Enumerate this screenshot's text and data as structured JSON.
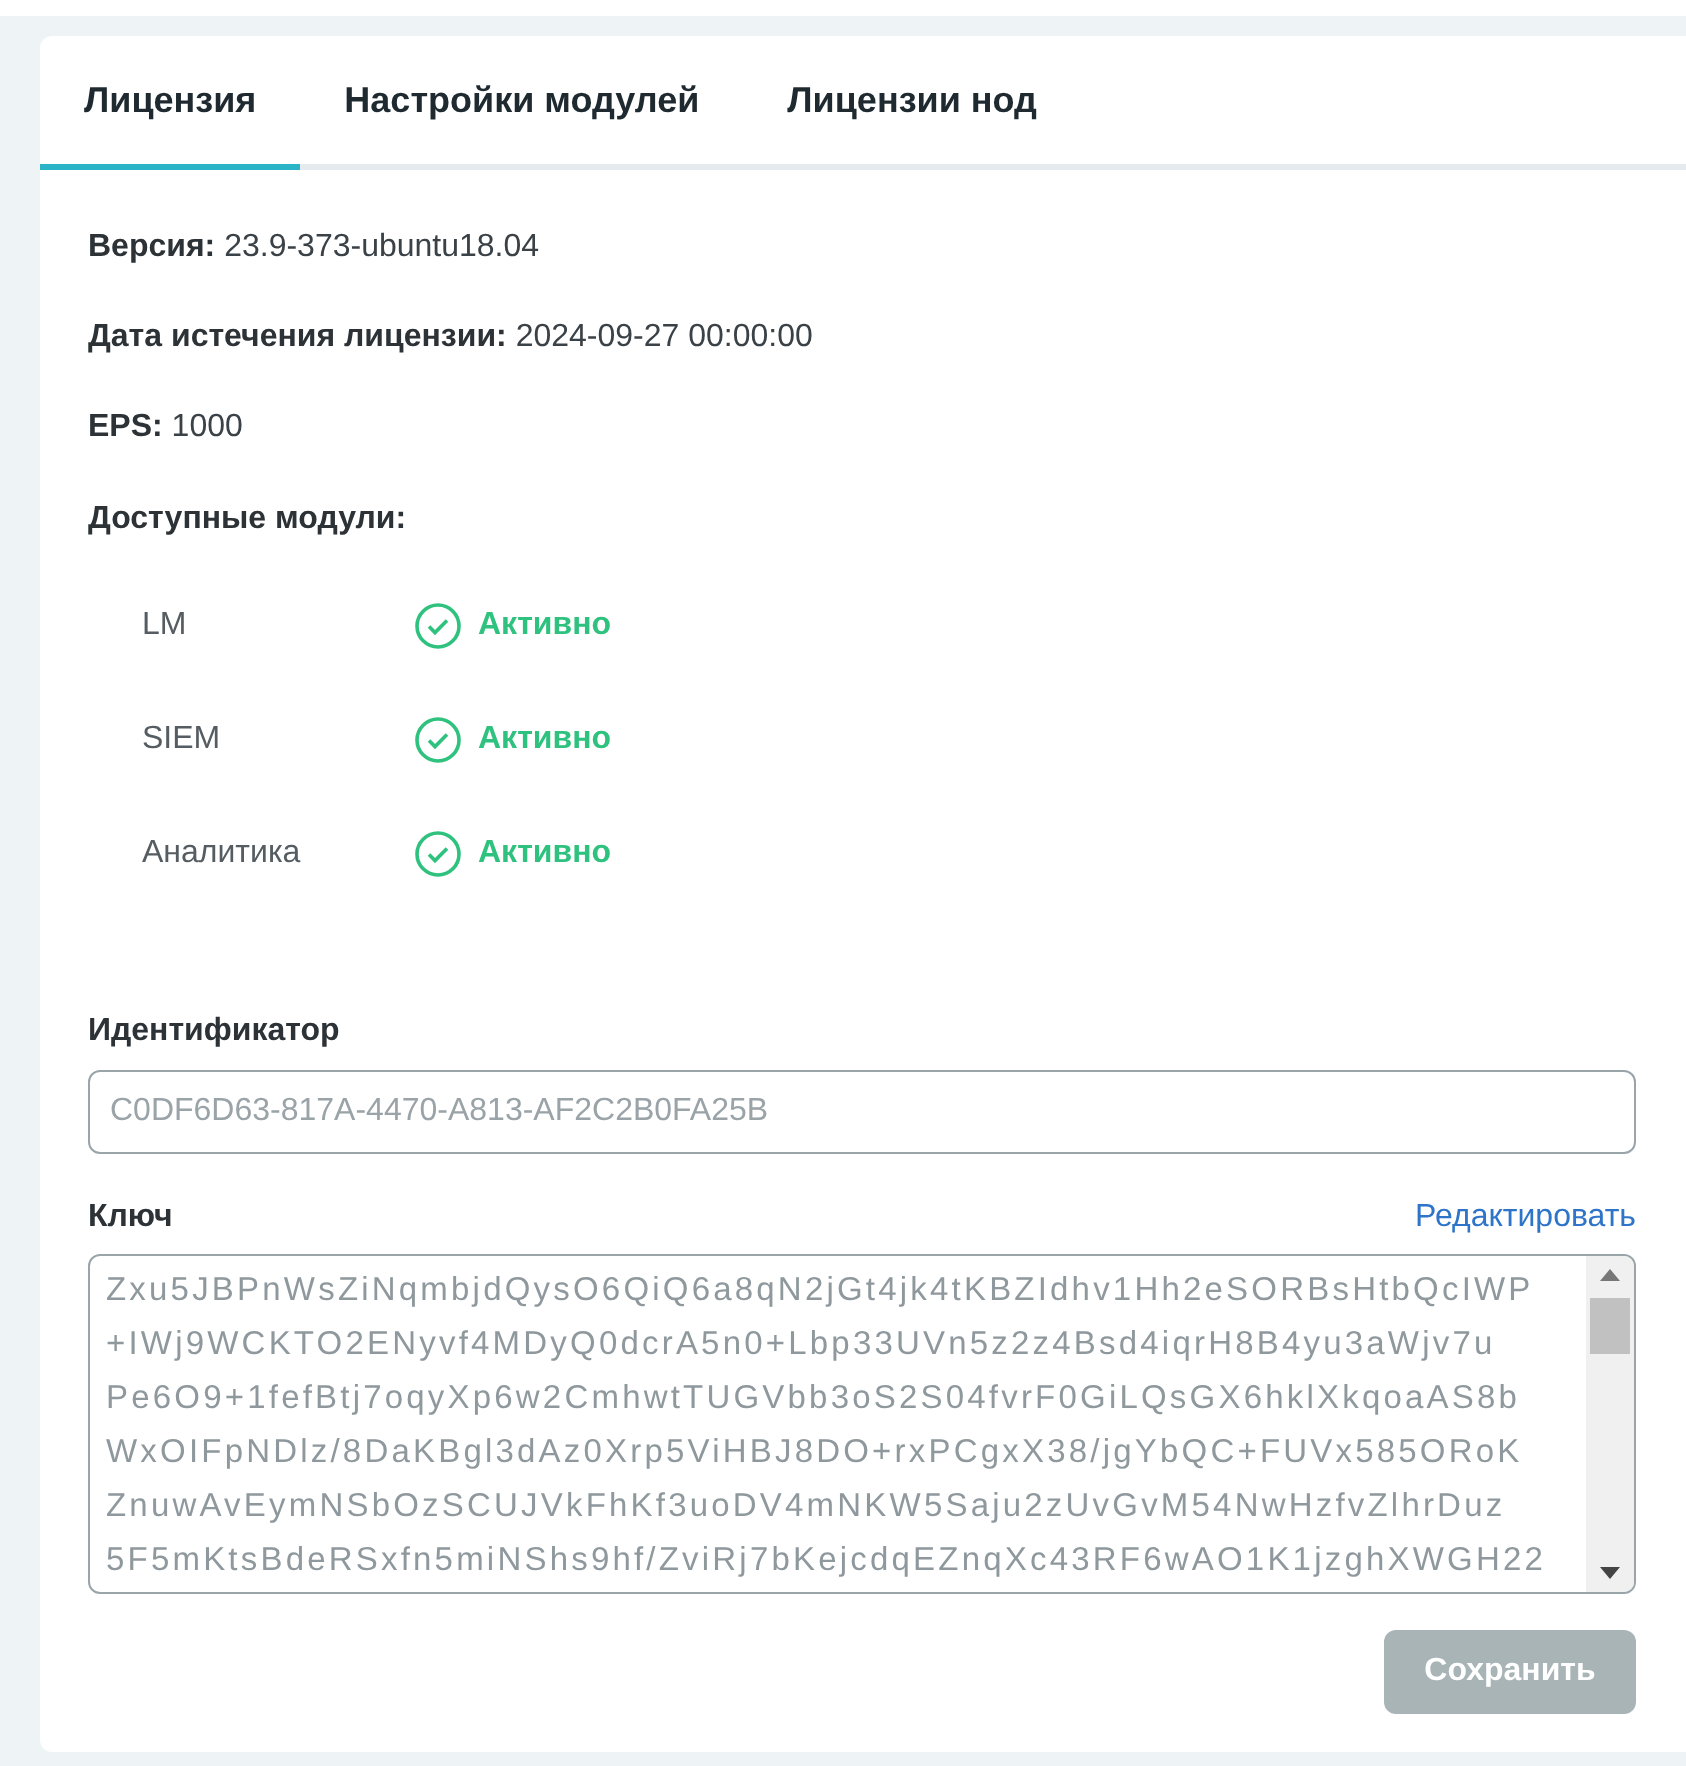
{
  "tabs": [
    {
      "label": "Лицензия",
      "selected": true
    },
    {
      "label": "Настройки модулей",
      "selected": false
    },
    {
      "label": "Лицензии нод",
      "selected": false
    }
  ],
  "info": [
    {
      "label": "Версия:",
      "value": "23.9-373-ubuntu18.04"
    },
    {
      "label": "Дата истечения лицензии:",
      "value": "2024-09-27 00:00:00"
    },
    {
      "label": "EPS:",
      "value": "1000"
    }
  ],
  "modules_title": "Доступные модули:",
  "modules": [
    {
      "name": "LM",
      "status": "Активно",
      "active": true
    },
    {
      "name": "SIEM",
      "status": "Активно",
      "active": true
    },
    {
      "name": "Аналитика",
      "status": "Активно",
      "active": true
    }
  ],
  "identifier": {
    "label": "Идентификатор",
    "placeholder": "C0DF6D63-817A-4470-A813-AF2C2B0FA25B"
  },
  "key": {
    "label": "Ключ",
    "edit_link": "Редактировать",
    "disabled": true,
    "lines": [
      "Zxu5JBPnWsZiNqmbjdQysO6QiQ6a8qN2jGt4jk4tKBZIdhv1Hh2eSORBsHtbQcIWP",
      "+IWj9WCKTO2ENyvf4MDyQ0dcrA5n0+Lbp33UVn5z2z4Bsd4iqrH8B4yu3aWjv7u",
      "Pe6O9+1fefBtj7oqyXp6w2CmhwtTUGVbb3oS2S04fvrF0GiLQsGX6hklXkqoaAS8b",
      "WxOIFpNDlz/8DaKBgl3dAz0Xrp5ViHBJ8DO+rxPCgxX38/jgYbQC+FUVx585ORoK",
      "ZnuwAvEymNSbOzSCUJVkFhKf3uoDV4mNKW5Saju2zUvGvM54NwHzfvZlhrDuz",
      "5F5mKtsBdeRSxfn5miNShs9hf/ZviRj7bKejcdqEZnqXc43RF6wAO1K1jzghXWGH22"
    ]
  },
  "save_button": {
    "label": "Сохранить",
    "disabled": true
  }
}
